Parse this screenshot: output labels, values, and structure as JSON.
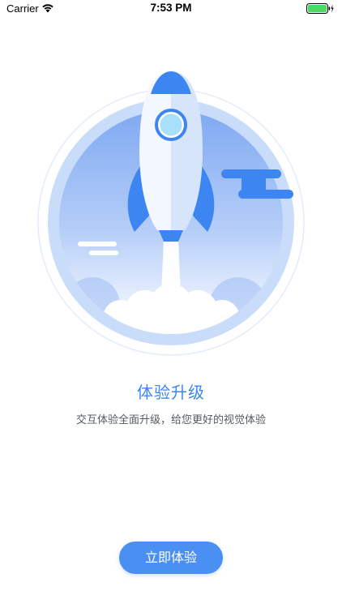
{
  "status_bar": {
    "carrier": "Carrier",
    "time": "7:53 PM",
    "wifi_icon": "wifi-icon",
    "battery_icon": "battery-icon",
    "battery_color": "#4cd964"
  },
  "illustration": {
    "icon": "rocket-launch-illustration",
    "circle_color": "#a9c8f8",
    "rocket_color": "#e6eefc",
    "accent_color": "#3d86f2"
  },
  "content": {
    "title": "体验升级",
    "subtitle": "交互体验全面升级，给您更好的视觉体验"
  },
  "actions": {
    "primary_label": "立即体验",
    "primary_color": "#4a8ff2"
  }
}
